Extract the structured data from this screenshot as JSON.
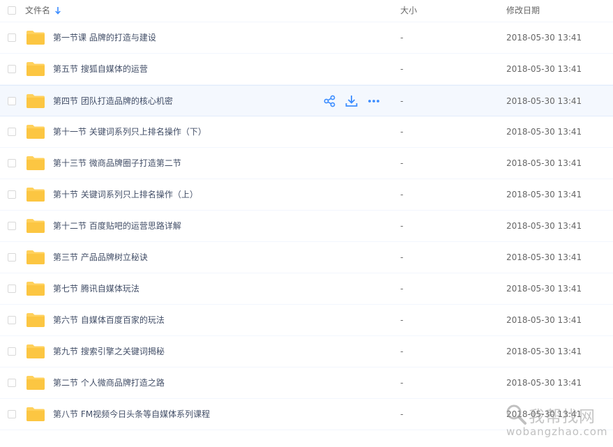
{
  "header": {
    "name_label": "文件名",
    "size_label": "大小",
    "date_label": "修改日期"
  },
  "files": [
    {
      "name": "第一节课 品牌的打造与建设",
      "size": "-",
      "date": "2018-05-30 13:41"
    },
    {
      "name": "第五节 搜狐自媒体的运营",
      "size": "-",
      "date": "2018-05-30 13:41"
    },
    {
      "name": "第四节 团队打造品牌的核心机密",
      "size": "-",
      "date": "2018-05-30 13:41"
    },
    {
      "name": "第十一节 关键词系列只上排名操作（下）",
      "size": "-",
      "date": "2018-05-30 13:41"
    },
    {
      "name": "第十三节 微商品牌圈子打造第二节",
      "size": "-",
      "date": "2018-05-30 13:41"
    },
    {
      "name": "第十节 关键词系列只上排名操作（上）",
      "size": "-",
      "date": "2018-05-30 13:41"
    },
    {
      "name": "第十二节 百度贴吧的运营思路详解",
      "size": "-",
      "date": "2018-05-30 13:41"
    },
    {
      "name": "第三节 产品品牌树立秘诀",
      "size": "-",
      "date": "2018-05-30 13:41"
    },
    {
      "name": "第七节 腾讯自媒体玩法",
      "size": "-",
      "date": "2018-05-30 13:41"
    },
    {
      "name": "第六节 自媒体百度百家的玩法",
      "size": "-",
      "date": "2018-05-30 13:41"
    },
    {
      "name": "第九节 搜索引擎之关键词揭秘",
      "size": "-",
      "date": "2018-05-30 13:41"
    },
    {
      "name": "第二节 个人微商品牌打造之路",
      "size": "-",
      "date": "2018-05-30 13:41"
    },
    {
      "name": "第八节 FM视频今日头条等自媒体系列课程",
      "size": "-",
      "date": "2018-05-30 13:41"
    }
  ],
  "hovered_index": 2,
  "icons": {
    "sort": "arrow-down-icon",
    "folder": "folder-icon",
    "share": "share-icon",
    "download": "download-icon",
    "more": "more-icon"
  },
  "colors": {
    "accent": "#3b8cff",
    "folder": "#ffd15c",
    "hover_row": "#f4f8fe"
  },
  "watermark": {
    "line1": "我帮找网",
    "line2": "wobangzhao.com"
  }
}
